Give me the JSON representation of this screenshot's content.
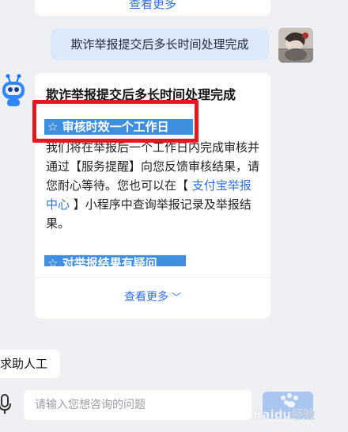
{
  "top_card": {
    "see_more_label": "查看更多"
  },
  "user_message": {
    "text": "欺诈举报提交后多长时间处理完成"
  },
  "answer": {
    "title": "欺诈举报提交后多长时间处理完成",
    "section1_heading": "☆  审核时效一个工作日",
    "body_before_link": "我们将在举报后一个工作日内完成审核并通过【服务提醒】向您反馈审核结果，请您耐心等待。您也可以在【 ",
    "link_text": "支付宝举报中心",
    "body_after_link": " 】小程序中查询举报记录及举报结果。",
    "section2_heading": "☆  对举报结果有疑问",
    "see_more_label": "查看更多",
    "see_more_icon": "chevron-down-icon"
  },
  "quick_reply": {
    "label": "求助人工"
  },
  "input": {
    "placeholder": "请输入您想咨询的问题",
    "value": ""
  },
  "watermark": {
    "text": "Baidu经验"
  },
  "colors": {
    "background": "#eef0f4",
    "user_bubble": "#dce9fb",
    "link": "#2f6fe0",
    "section_highlight": "#3f8fe0",
    "annotation_box": "#e8151f"
  }
}
